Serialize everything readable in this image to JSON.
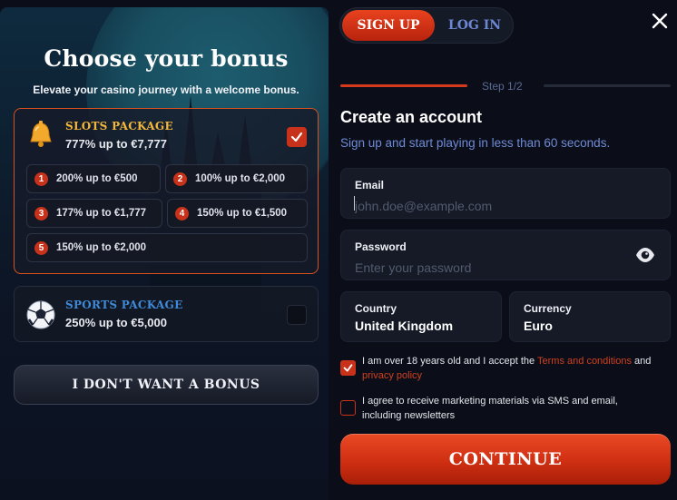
{
  "bonus": {
    "title": "Choose your bonus",
    "subtitle": "Elevate your casino journey with a welcome bonus.",
    "slots": {
      "name": "Slots package",
      "offer": "777% up to €7,777",
      "selected": true,
      "chips": [
        {
          "num": "1",
          "text": "200% up to €500"
        },
        {
          "num": "2",
          "text": "100% up to €2,000"
        },
        {
          "num": "3",
          "text": "177% up to €1,777"
        },
        {
          "num": "4",
          "text": "150% up to €1,500"
        },
        {
          "num": "5",
          "text": "150% up to €2,000"
        }
      ]
    },
    "sports": {
      "name": "Sports package",
      "offer": "250% up to €5,000",
      "selected": false
    },
    "no_bonus_label": "I DON'T WANT A BONUS"
  },
  "auth": {
    "tab_signup": "SIGN UP",
    "tab_login": "LOG IN",
    "active_tab": "signup"
  },
  "form": {
    "step": "Step 1/2",
    "title": "Create an account",
    "subtitle": "Sign up and start playing in less than 60 seconds.",
    "email_label": "Email",
    "email_placeholder": "john.doe@example.com",
    "password_label": "Password",
    "password_placeholder": "Enter your password",
    "country_label": "Country",
    "country_value": "United Kingdom",
    "currency_label": "Currency",
    "currency_value": "Euro",
    "terms_prefix": "I am over 18 years old and I accept the ",
    "terms_link": "Terms and conditions",
    "terms_and": " and",
    "privacy_link": "privacy policy",
    "terms_checked": true,
    "marketing_text": "I agree to receive marketing materials via SMS and email, including newsletters",
    "marketing_checked": false,
    "continue_label": "CONTINUE"
  },
  "colors": {
    "accent": "#c8321a",
    "gold": "#f4b73a",
    "sports_blue": "#3f8ad8",
    "link_blue": "#6f8bd6",
    "background": "#0b0e18"
  },
  "icons": {
    "slots": "bell-icon",
    "sports": "soccer-ball-icon",
    "close": "close-icon",
    "password_toggle": "eye-icon",
    "check": "check-icon"
  }
}
